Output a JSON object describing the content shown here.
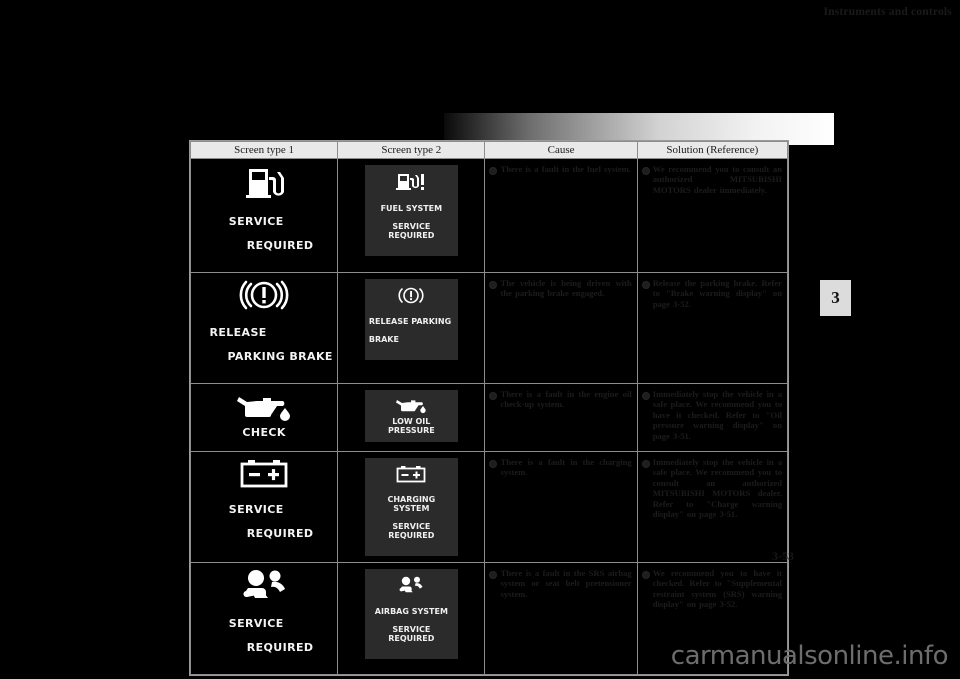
{
  "header": {
    "title": "Instruments and controls",
    "chapter": "3"
  },
  "footer": {
    "page_number": "3-53",
    "watermark": "carmanualsonline.info"
  },
  "table": {
    "columns": [
      "Screen type 1",
      "Screen type 2",
      "Cause",
      "Solution (Reference)"
    ],
    "rows": [
      {
        "screen1": {
          "icon": "fuel-pump-icon",
          "label_line1": "SERVICE",
          "label_line2": "REQUIRED"
        },
        "screen2": {
          "icon": "fuel-pump-exclamation-icon",
          "label_line1": "FUEL SYSTEM",
          "label_line2": "SERVICE REQUIRED"
        },
        "cause": "There is a fault in the fuel system.",
        "solution": "We recommend you to consult an authorized MITSUBISHI MOTORS dealer immediately."
      },
      {
        "screen1": {
          "icon": "brake-warning-icon",
          "label_line1": "RELEASE",
          "label_line2": "PARKING BRAKE"
        },
        "screen2": {
          "icon": "brake-warning-icon",
          "label_line1": "RELEASE PARKING",
          "label_line2": "BRAKE"
        },
        "cause": "The vehicle is being driven with the parking brake engaged.",
        "solution": "Release the parking brake. Refer to \"Brake warning display\" on page 3-52."
      },
      {
        "screen1": {
          "icon": "oil-can-icon",
          "label_line1": "CHECK",
          "label_line2": ""
        },
        "screen2": {
          "icon": "oil-can-icon",
          "label_line1": "LOW OIL PRESSURE",
          "label_line2": ""
        },
        "cause": "There is a fault in the engine oil check-up system.",
        "solution": "Immediately stop the vehicle in a safe place. We recommend you to have it checked. Refer to \"Oil pressure warning display\" on page 3-51."
      },
      {
        "screen1": {
          "icon": "battery-icon",
          "label_line1": "SERVICE",
          "label_line2": "REQUIRED"
        },
        "screen2": {
          "icon": "battery-icon",
          "label_line1": "CHARGING SYSTEM",
          "label_line2": "SERVICE REQUIRED"
        },
        "cause": "There is a fault in the charging system.",
        "solution": "Immediately stop the vehicle in a safe place. We recommend you to consult an authorized MITSUBISHI MOTORS dealer. Refer to \"Charge warning display\" on page 3-51."
      },
      {
        "screen1": {
          "icon": "airbag-icon",
          "label_line1": "SERVICE",
          "label_line2": "REQUIRED"
        },
        "screen2": {
          "icon": "airbag-icon",
          "label_line1": "AIRBAG SYSTEM",
          "label_line2": "SERVICE REQUIRED"
        },
        "cause": "There is a fault in the SRS airbag system or seat belt pretensioner system.",
        "solution": "We recommend you to have it checked. Refer to \"Supplemental restraint system (SRS) warning display\" on page 3-52."
      }
    ]
  }
}
